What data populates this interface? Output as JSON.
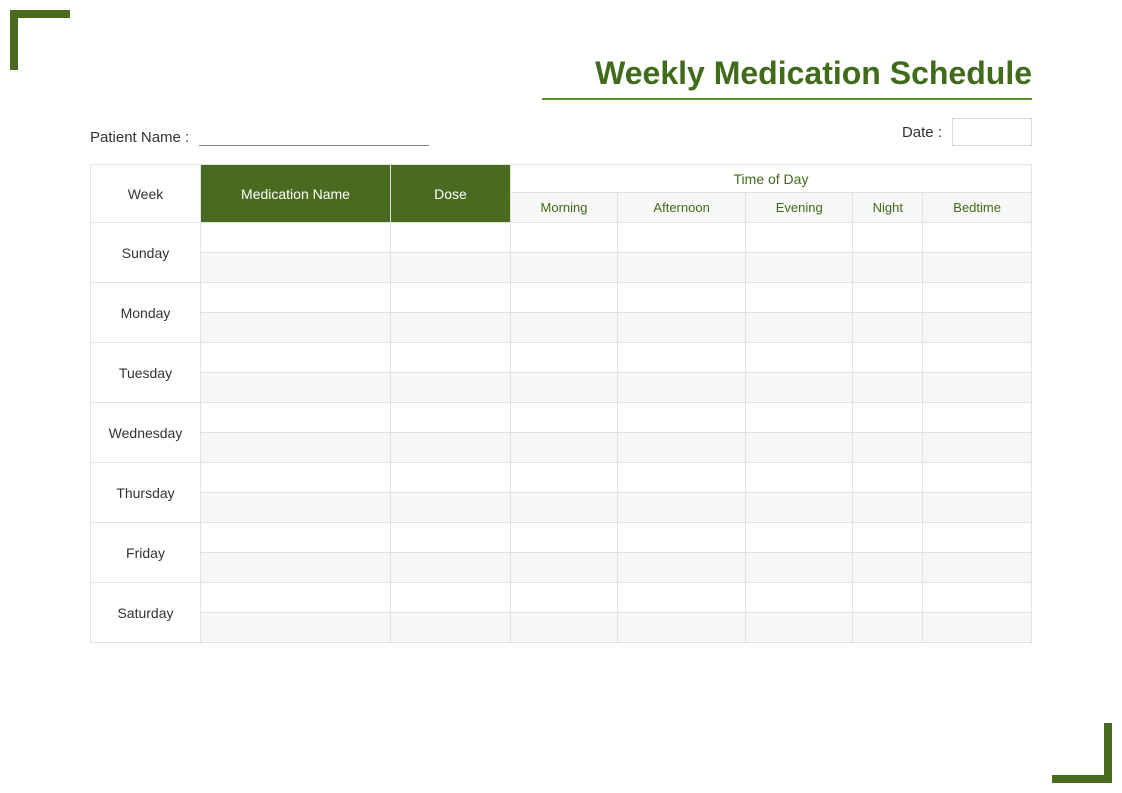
{
  "title": "Weekly Medication Schedule",
  "labels": {
    "patient_name": "Patient Name  :",
    "date": "Date :",
    "week": "Week",
    "medication_name": "Medication Name",
    "dose": "Dose",
    "time_of_day": "Time of Day"
  },
  "time_columns": [
    "Morning",
    "Afternoon",
    "Evening",
    "Night",
    "Bedtime"
  ],
  "days": [
    "Sunday",
    "Monday",
    "Tuesday",
    "Wednesday",
    "Thursday",
    "Friday",
    "Saturday"
  ],
  "fields": {
    "patient_name_value": "",
    "date_value": ""
  },
  "colors": {
    "accent": "#4a6b1f",
    "accent_text": "#3f6b1a",
    "row_alt": "#f7f7f5",
    "border": "#e2e2e2"
  }
}
